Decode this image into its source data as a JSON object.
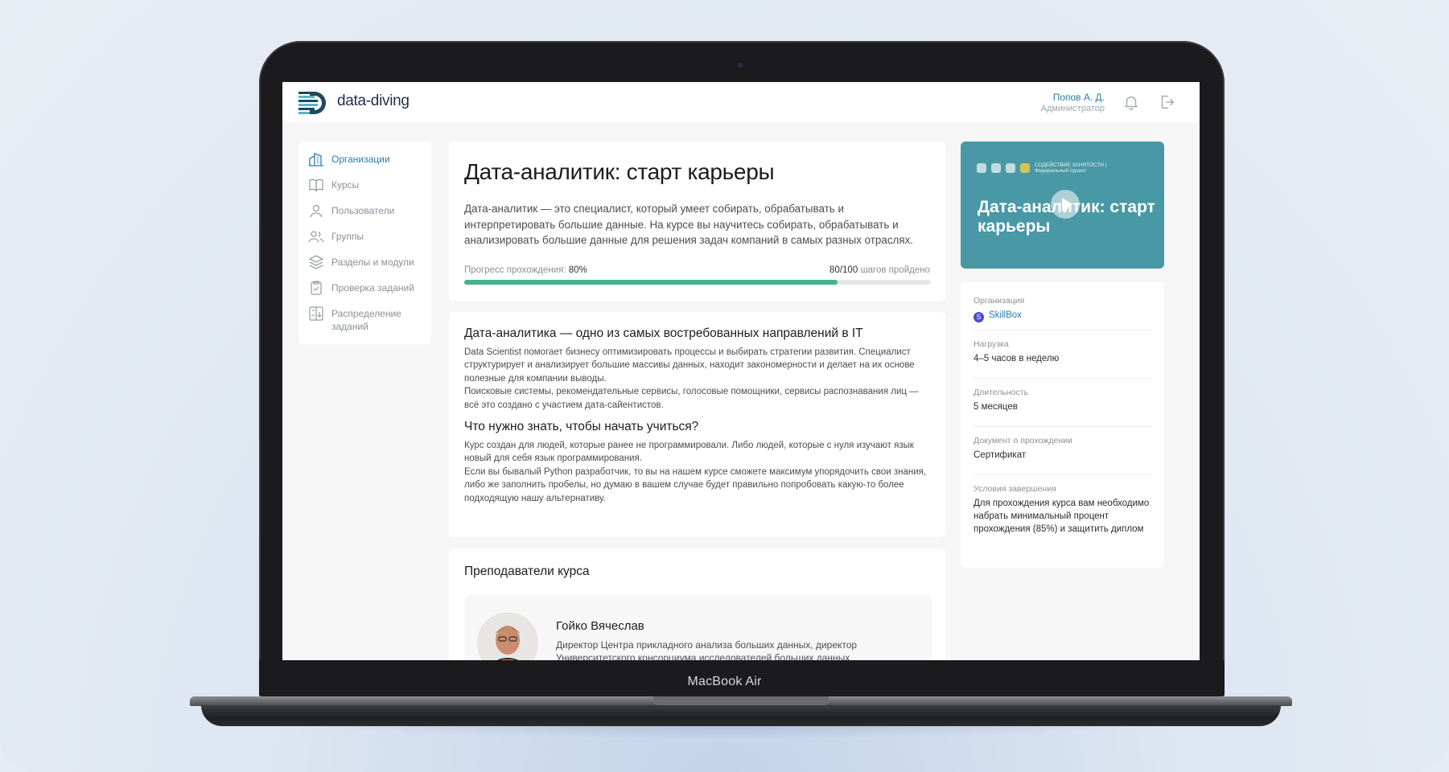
{
  "device_label": "MacBook Air",
  "header": {
    "logo_text": "data-diving",
    "user_name": "Попов А. Д.",
    "user_role": "Администратор"
  },
  "sidebar": {
    "items": [
      {
        "label": "Организации",
        "icon": "buildings-icon",
        "active": true
      },
      {
        "label": "Курсы",
        "icon": "book-icon"
      },
      {
        "label": "Пользователи",
        "icon": "user-icon"
      },
      {
        "label": "Группы",
        "icon": "users-icon"
      },
      {
        "label": "Разделы и модули",
        "icon": "layers-icon"
      },
      {
        "label": "Проверка заданий",
        "icon": "clipboard-check-icon"
      },
      {
        "label": "Распределение заданий",
        "icon": "distribute-icon"
      }
    ]
  },
  "course": {
    "title": "Дата-аналитик: старт карьеры",
    "description": "Дата-аналитик — это специалист, который умеет собирать, обрабатывать и интерпретировать большие данные. На курсе вы научитесь собирать, обрабатывать и анализировать большие данные для решения задач компаний в самых разных отраслях.",
    "progress_label": "Прогресс прохождения:",
    "progress_value": "80%",
    "progress_fraction": 0.8,
    "steps_value": "80/100",
    "steps_label": "шагов пройдено"
  },
  "about": {
    "heading1": "Дата-аналитика — одно из самых востребованных направлений в IT",
    "para1": "Data Scientist помогает бизнесу оптимизировать процессы и выбирать стратегии развития. Специалист структурирует и анализирует большие массивы данных, находит закономерности и делает на их основе полезные для компании выводы.",
    "para2": "Поисковые системы, рекомендательные сервисы, голосовые помощники, сервисы распознавания лиц — всё это создано с участием дата-сайентистов.",
    "heading2": "Что нужно знать, чтобы начать учиться?",
    "para3": "Курс создан для людей, которые ранее не программировали. Либо людей, которые с нуля изучают язык новый для себя язык программирования.",
    "para4": "Если вы бывалый Python разработчик, то вы на нашем курсе сможете максимум упорядочить свои знания, либо же заполнить пробелы, но думаю в вашем случае будет правильно попробовать какую-то более подходящую нашу альтернативу."
  },
  "teachers": {
    "heading": "Преподаватели курса",
    "items": [
      {
        "name": "Гойко Вячеслав",
        "role": "Директор Центра прикладного анализа больших данных, директор Университетского консорциума исследователей больших данных"
      }
    ]
  },
  "video": {
    "banner_caption": "СОДЕЙСТВИЕ ЗАНЯТОСТИ | Федеральный проект",
    "title": "Дата-аналитик: старт карьеры"
  },
  "info": {
    "org_label": "Организация",
    "org_value": "SkillBox",
    "org_badge": "S",
    "load_label": "Нагрузка",
    "load_value": "4–5 часов в неделю",
    "duration_label": "Длительность",
    "duration_value": "5 месяцев",
    "doc_label": "Документ о прохождении",
    "doc_value": "Сертификат",
    "cond_label": "Условия завершения",
    "cond_value": "Для прохождения курса вам необходимо набрать минимальный процент прохождения (85%) и защитить диплом"
  },
  "colors": {
    "accent": "#2a7cae",
    "progress": "#46b38f",
    "video_bg": "#4998a6"
  }
}
